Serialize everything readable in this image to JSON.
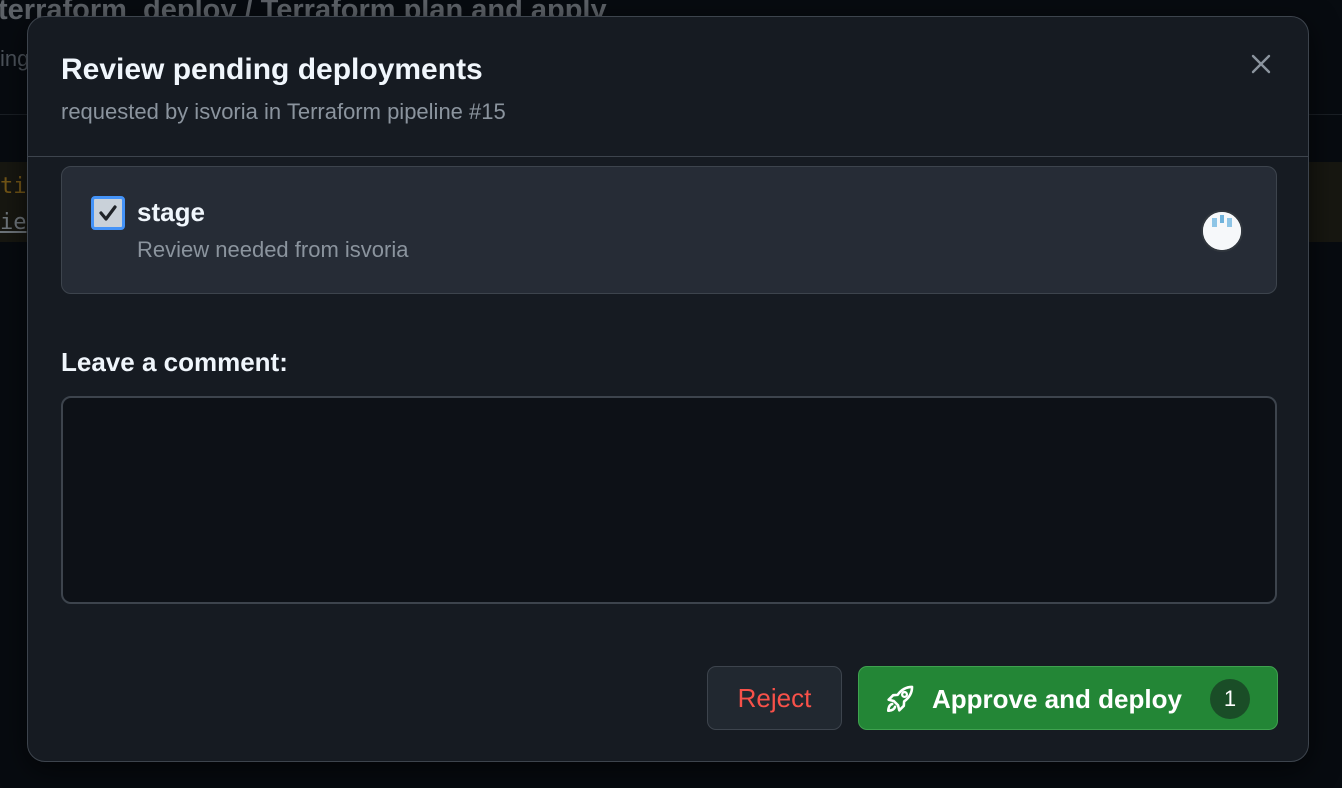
{
  "background": {
    "title": "terraform_deploy / Terraform plan and apply",
    "subtitle_fragment": "ing",
    "code_line_1": "ti",
    "code_line_2": "ie"
  },
  "dialog": {
    "title": "Review pending deployments",
    "subtitle": "requested by isvoria in Terraform pipeline #15",
    "close_icon": "x-icon"
  },
  "environment": {
    "name": "stage",
    "checked": true,
    "description": "Review needed from isvoria",
    "avatar_icon": "user-avatar-icon"
  },
  "comment": {
    "label": "Leave a comment:",
    "value": "",
    "placeholder": ""
  },
  "actions": {
    "reject_label": "Reject",
    "approve_label": "Approve and deploy",
    "approve_count": "1",
    "approve_icon": "rocket-icon"
  },
  "colors": {
    "dialog_bg": "#161b22",
    "primary_green": "#238636",
    "danger_red": "#f85149",
    "checkbox_blue": "#4493f8"
  }
}
